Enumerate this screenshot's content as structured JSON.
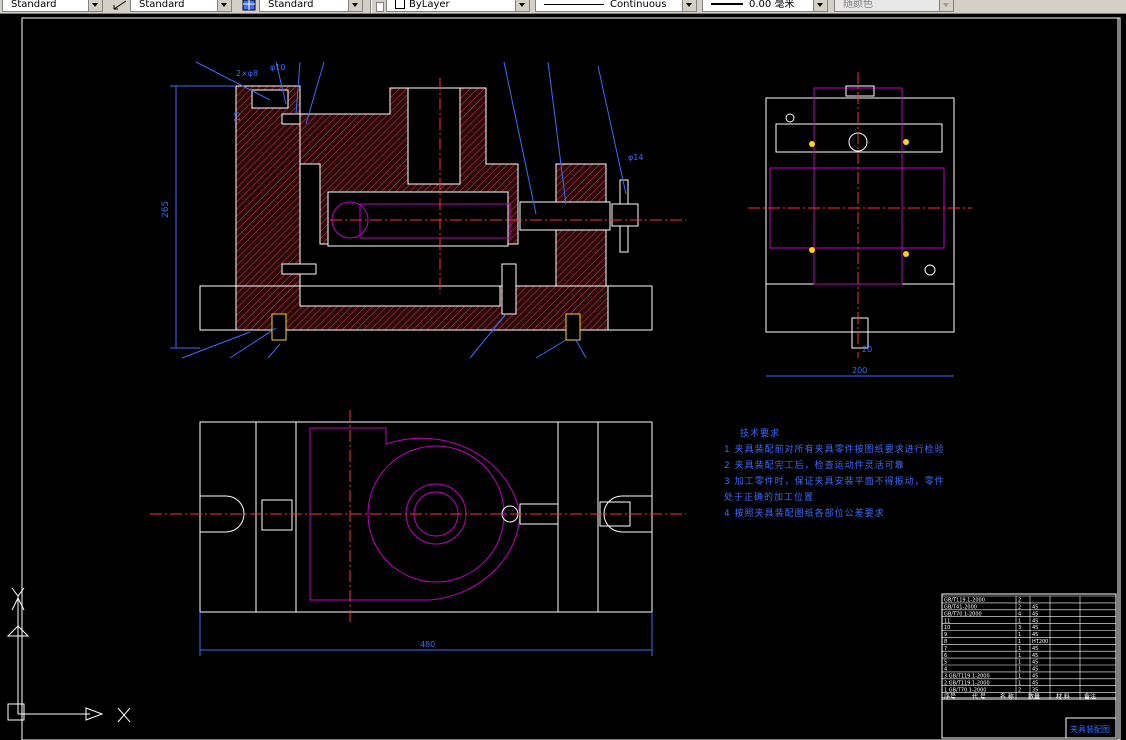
{
  "toolbar": {
    "text_style": "Standard",
    "dim_style": "Standard",
    "table_style": "Standard",
    "layer": "ByLayer",
    "linetype": "Continuous",
    "lineweight": "0.00 毫米",
    "plot_style": "随颜色"
  },
  "drawing": {
    "dimensions": {
      "height_left": "265",
      "width_side": "200",
      "width_bottom": "480",
      "dim_top_a": "2×φ8",
      "dim_top_b": "φ10",
      "dim_side_a": "10",
      "dim_right_a": "φ14",
      "dim_bottom_side": "20"
    },
    "requirements_title": "技术要求",
    "requirements": [
      "1  夹具装配前对所有夹具零件按图纸要求进行检验",
      "2  夹具装配完工后，检查运动件灵活可靠",
      "3  加工零件时，保证夹具安装平面不得振动，零件",
      "    处于正确的加工位置",
      "4  按照夹具装配图纸各部位公差要求"
    ],
    "title_block": {
      "bom_header": [
        "序号",
        "代 号",
        "名 称",
        "数量",
        "材 料",
        "备注"
      ],
      "bom_rows": [
        [
          "GB/T119.1-2000",
          "2",
          "",
          ""
        ],
        [
          "GB/T41-2000",
          "2",
          "45",
          ""
        ],
        [
          "GB/T70.1-2000",
          "4",
          "45",
          ""
        ],
        [
          "11",
          "1",
          "45",
          ""
        ],
        [
          "10",
          "3",
          "45",
          ""
        ],
        [
          "9",
          "1",
          "45",
          ""
        ],
        [
          "8",
          "1",
          "HT200",
          ""
        ],
        [
          "7",
          "1",
          "45",
          ""
        ],
        [
          "6",
          "1",
          "45",
          ""
        ],
        [
          "5",
          "1",
          "45",
          ""
        ],
        [
          "4",
          "1",
          "45",
          ""
        ],
        [
          "3 GB/T119.1-2000",
          "1",
          "45",
          ""
        ],
        [
          "2 GB/T119.1-2000",
          "1",
          "45",
          ""
        ],
        [
          "1 GB/T70.1-2000",
          "2",
          "35",
          ""
        ]
      ],
      "drawing_name": "夹具装配图"
    }
  }
}
